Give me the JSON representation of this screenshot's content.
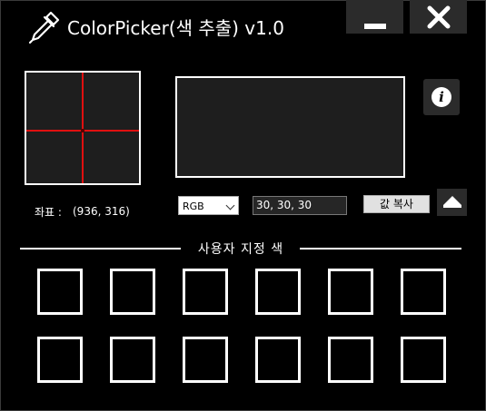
{
  "window": {
    "title": "ColorPicker(색 추출) v1.0",
    "app_icon": "eyedropper-icon",
    "minimize_icon": "minimize-icon",
    "close_icon": "close-icon"
  },
  "magnifier": {
    "crosshair_color": "#e01010"
  },
  "preview": {
    "color": "#1e1e1e"
  },
  "info": {
    "label": "i",
    "icon": "info-icon"
  },
  "coordinates": {
    "label": "좌표 :",
    "value": "(936, 316)"
  },
  "value_row": {
    "mode_selected": "RGB",
    "value": "30, 30, 30",
    "copy_label": "값 복사",
    "collapse_icon": "eject-icon"
  },
  "custom_colors": {
    "title": "사용자 지정 색",
    "swatches": [
      "",
      "",
      "",
      "",
      "",
      "",
      "",
      "",
      "",
      "",
      "",
      ""
    ]
  }
}
